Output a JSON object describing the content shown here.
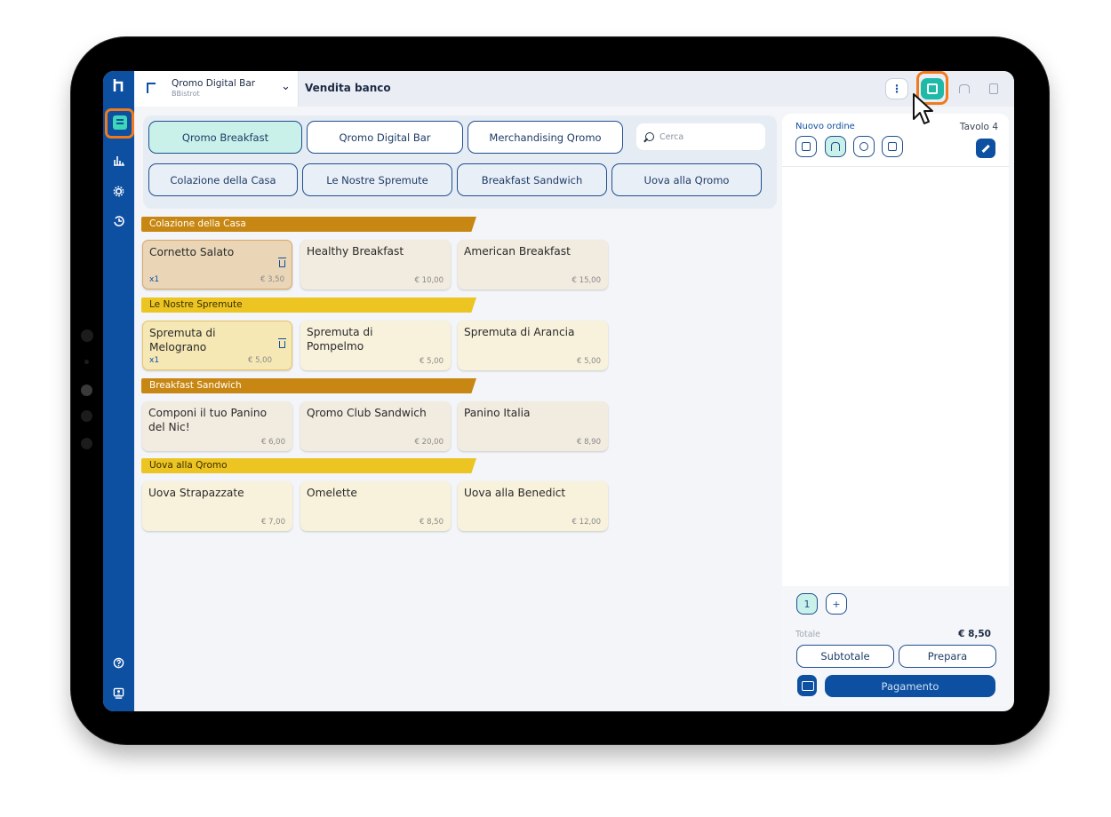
{
  "header": {
    "venue_name": "Qromo Digital Bar",
    "venue_sub": "BBistrot",
    "title": "Vendita banco",
    "more_label": "⋮"
  },
  "categories": {
    "top": [
      "Qromo Breakfast",
      "Qromo Digital Bar",
      "Merchandising Qromo"
    ],
    "sub": [
      "Colazione della Casa",
      "Le Nostre Spremute",
      "Breakfast Sandwich",
      "Uova alla Qromo"
    ],
    "search_placeholder": "Cerca"
  },
  "sections": [
    {
      "title": "Colazione della Casa",
      "items": [
        {
          "name": "Cornetto Salato",
          "price": "€ 3,50",
          "qty": "x1"
        },
        {
          "name": "Healthy Breakfast",
          "price": "€ 10,00"
        },
        {
          "name": "American Breakfast",
          "price": "€ 15,00"
        }
      ]
    },
    {
      "title": "Le Nostre Spremute",
      "items": [
        {
          "name": "Spremuta di Melograno",
          "price": "€ 5,00",
          "qty": "x1"
        },
        {
          "name": "Spremuta di Pompelmo",
          "price": "€ 5,00"
        },
        {
          "name": "Spremuta di Arancia",
          "price": "€ 5,00"
        }
      ]
    },
    {
      "title": "Breakfast Sandwich",
      "items": [
        {
          "name": "Componi il tuo Panino del Nic!",
          "price": "€ 6,00"
        },
        {
          "name": "Qromo Club Sandwich",
          "price": "€ 20,00"
        },
        {
          "name": "Panino Italia",
          "price": "€ 8,90"
        }
      ]
    },
    {
      "title": "Uova alla Qromo",
      "items": [
        {
          "name": "Uova Strapazzate",
          "price": "€ 7,00"
        },
        {
          "name": "Omelette",
          "price": "€ 8,50"
        },
        {
          "name": "Uova alla Benedict",
          "price": "€ 12,00"
        }
      ]
    }
  ],
  "order": {
    "title": "Nuovo ordine",
    "table": "Tavolo 4",
    "course_label": "1",
    "add_course_label": "+",
    "total_label": "Totale",
    "total_value": "€ 8,50",
    "subtotal_label": "Subtotale",
    "prepare_label": "Prepara",
    "pay_label": "Pagamento"
  },
  "colors": {
    "sidebar": "#0d4fa0",
    "accent": "#1fb9a8",
    "highlight": "#f07a1d",
    "section_gold": "#c88712",
    "section_yellow": "#ecc523"
  }
}
